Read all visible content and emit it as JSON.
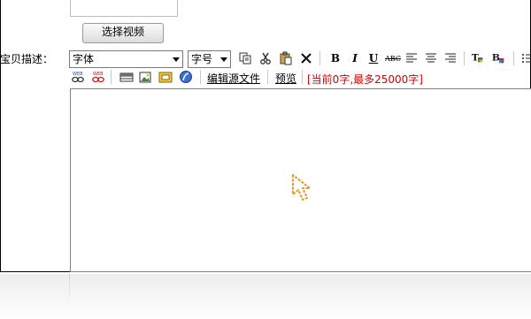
{
  "upload": {
    "video_button_label": "选择视频"
  },
  "description_row": {
    "label": "宝贝描述："
  },
  "toolbar": {
    "font_select_value": "字体",
    "size_select_value": "字号",
    "bold": "B",
    "italic": "I",
    "underline": "U",
    "strike": "ABC",
    "edit_source_link": "编辑源文件",
    "preview_link": "预览",
    "counter_text": "[当前0字,最多25000字]"
  },
  "editor": {
    "content": ""
  },
  "colors": {
    "counter": "#d40000",
    "cursor": "#e8961e"
  }
}
